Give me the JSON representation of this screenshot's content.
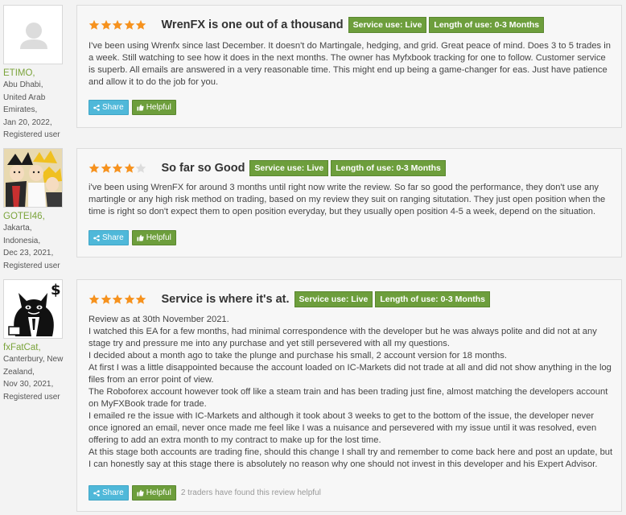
{
  "accent": "#6d9e3c",
  "share_color": "#4fb8d9",
  "star_color": "#f6921e",
  "reviews": [
    {
      "user": {
        "name": "ETIMO,",
        "location": "Abu Dhabi, United Arab Emirates,",
        "date": "Jan 20, 2022,",
        "status": "Registered user",
        "avatar": "default-person-icon"
      },
      "rating": 5,
      "title": "WrenFX is one out of a thousand",
      "service_use": "Service use: Live",
      "length_of_use": "Length of use: 0-3 Months",
      "paragraphs": [
        "I've been using Wrenfx since last December. It doesn't do Martingale, hedging, and grid. Great peace of mind. Does 3 to 5 trades in a week. Still watching to see how it does in the next months. The owner has Myfxbook tracking for one to follow. Customer service is superb. All emails are answered in a very reasonable time. This might end up being a game-changer for eas. Just have patience and allow it to do the job for you."
      ],
      "share_label": "Share",
      "helpful_label": "Helpful",
      "helpful_note": ""
    },
    {
      "user": {
        "name": "GOTEI46,",
        "location": "Jakarta, Indonesia,",
        "date": "Dec 23, 2021,",
        "status": "Registered user",
        "avatar": "anime-characters-avatar"
      },
      "rating": 4,
      "title": "So far so Good",
      "service_use": "Service use: Live",
      "length_of_use": "Length of use: 0-3 Months",
      "paragraphs": [
        "i've been using WrenFX for around 3 months until right now write the review. So far so good the performance, they don't use any martingle or any high risk method on trading, based on my review they suit on ranging situtation. They just open position when the time is right so don't expect them to open position everyday, but they usually open position 4-5 a week, depend on the situation."
      ],
      "share_label": "Share",
      "helpful_label": "Helpful",
      "helpful_note": ""
    },
    {
      "user": {
        "name": "fxFatCat,",
        "location": "Canterbury, New Zealand,",
        "date": "Nov 30, 2021,",
        "status": "Registered user",
        "avatar": "fat-cat-money-avatar"
      },
      "rating": 5,
      "title": "Service is where it's at.",
      "service_use": "Service use: Live",
      "length_of_use": "Length of use: 0-3 Months",
      "paragraphs": [
        "Review as at 30th November 2021.",
        "I watched this EA for a few months, had minimal correspondence with the developer but he was always polite and did not at any stage try and pressure me into any purchase and yet still persevered with all my questions.",
        "I decided about a month ago to take the plunge and purchase his small, 2 account version for 18 months.",
        "At first I was a little disappointed because the account loaded on IC-Markets did not trade at all and did not show anything in the log files from an error point of view.",
        "The Roboforex account however took off like a steam train and has been trading just fine, almost matching the developers account on MyFXBook trade for trade.",
        "I emailed re the issue with IC-Markets and although it took about 3 weeks to get to the bottom of the issue, the developer never once ignored an email, never once made me feel like I was a nuisance and persevered with my issue until it was resolved, even offering to add an extra month to my contract to make up for the lost time.",
        "At this stage both accounts are trading fine, should this change I shall try and remember to come back here and post an update, but I can honestly say at this stage there is absolutely no reason why one should not invest in this developer and his Expert Advisor."
      ],
      "share_label": "Share",
      "helpful_label": "Helpful",
      "helpful_note": "2 traders have found this review helpful"
    }
  ]
}
